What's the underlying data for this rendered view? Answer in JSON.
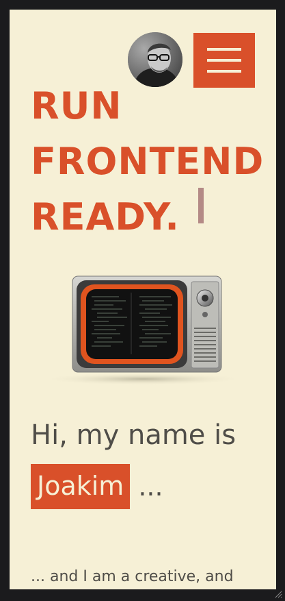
{
  "header": {
    "avatar_alt": "Joakim portrait",
    "menu_label": "Menu"
  },
  "hero": {
    "headline_lines": [
      "RUN",
      "FRONTEND",
      "READY."
    ]
  },
  "intro": {
    "greeting": "Hi, my name is",
    "name": "Joakim",
    "ellipsis": "...",
    "tagline": "... and I am a creative, and"
  },
  "colors": {
    "accent": "#d9502a",
    "background": "#f6f0d6",
    "text": "#4f4d48",
    "cursor": "#b48a86",
    "frame": "#1b1b1d"
  },
  "icons": {
    "menu": "hamburger-icon",
    "avatar": "avatar",
    "illustration": "retro-tv",
    "resize": "resize-grip-icon"
  }
}
